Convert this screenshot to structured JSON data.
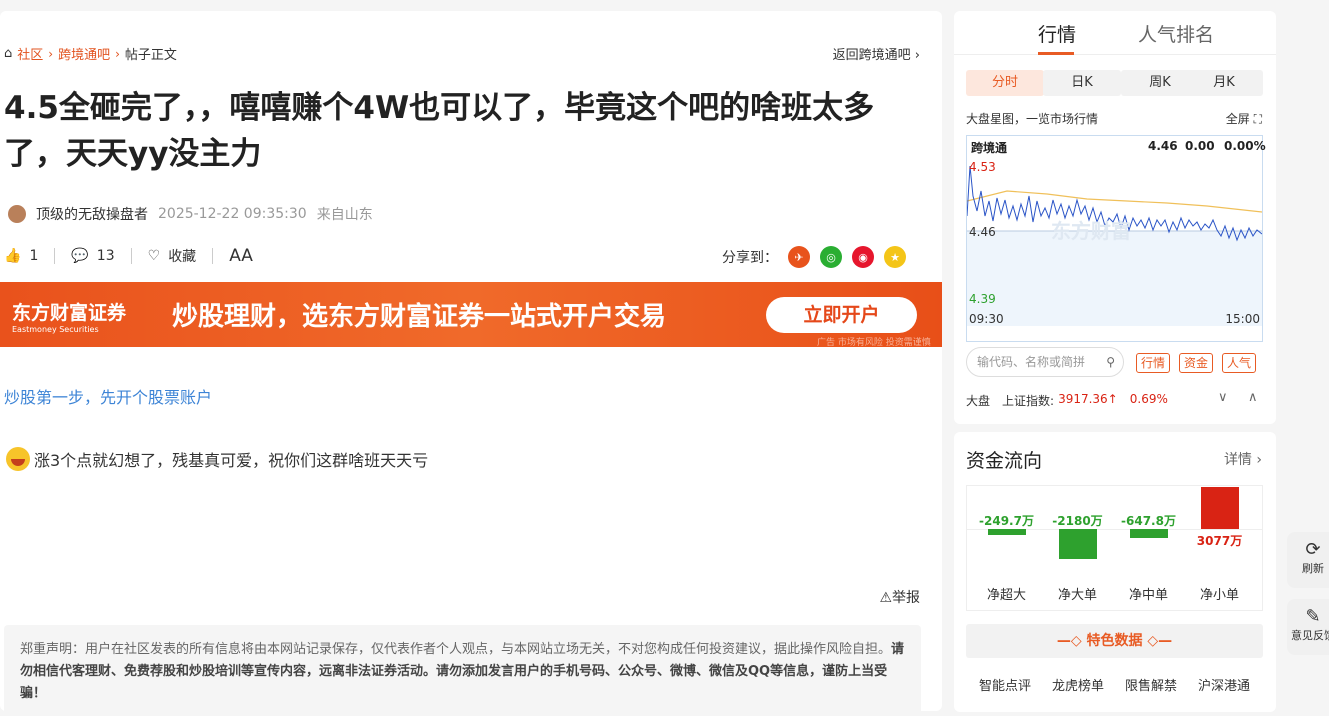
{
  "breadcrumb": {
    "home": "社区",
    "bar": "跨境通吧",
    "current": "帖子正文",
    "back": "返回跨境通吧"
  },
  "post": {
    "title": "4.5全砸完了，，嘻嘻赚个4W也可以了，毕竟这个吧的啥班太多了，天天yy没主力",
    "author": "顶级的无敌操盘者",
    "time": "2025-12-22 09:35:30",
    "location": "来自山东",
    "likes": "1",
    "comments": "13",
    "favorite": "收藏",
    "fontsize": "AA",
    "share_label": "分享到：",
    "link": "炒股第一步，先开个股票账户",
    "body": "涨3个点就幻想了，残基真可爱，祝你们这群啥班天天亏",
    "report": "举报"
  },
  "banner": {
    "logo": "东方财富证券",
    "logo_en": "Eastmoney Securities",
    "slogan": "炒股理财，选东方财富证券一站式开户交易",
    "button": "立即开户",
    "tiny": "广告 市场有风险 投资需谨慎"
  },
  "disclaimer": {
    "lead": "郑重声明：用户在社区发表的所有信息将由本网站记录保存，仅代表作者个人观点，与本网站立场无关，不对您构成任何投资建议，据此操作风险自担。",
    "bold": "请勿相信代客理财、免费荐股和炒股培训等宣传内容，远离非法证券活动。请勿添加发言用户的手机号码、公众号、微博、微信及QQ等信息，谨防上当受骗！"
  },
  "market": {
    "tab1": "行情",
    "tab2": "人气排名",
    "k1": "分时",
    "k2": "日K",
    "k3": "周K",
    "k4": "月K",
    "mini": "大盘星图，一览市场行情",
    "full": "全屏",
    "name": "跨境通",
    "price": "4.46",
    "change": "0.00",
    "pct": "0.00%",
    "high": "4.53",
    "mid": "4.46",
    "low": "4.39",
    "t_start": "09:30",
    "t_end": "15:00",
    "watermark": "东方财富",
    "search_ph": "输代码、名称或简拼",
    "tags": [
      "行情",
      "资金",
      "人气"
    ],
    "idx_label": "大盘",
    "idx_name": "上证指数:",
    "idx_value": "3917.36↑",
    "idx_pct": "0.69%"
  },
  "flow": {
    "title": "资金流向",
    "detail": "详情",
    "items": [
      {
        "label": "净超大",
        "value": "-249.7万",
        "num": -249.7
      },
      {
        "label": "净大单",
        "value": "-2180万",
        "num": -2180
      },
      {
        "label": "净中单",
        "value": "-647.8万",
        "num": -647.8
      },
      {
        "label": "净小单",
        "value": "3077万",
        "num": 3077
      }
    ],
    "feature": "特色数据",
    "links": [
      "智能点评",
      "龙虎榜单",
      "限售解禁",
      "沪深港通"
    ]
  },
  "float": {
    "refresh": "刷新",
    "feedback": "意见反馈"
  },
  "colors": {
    "accent": "#e85b24",
    "up": "#d92314",
    "down": "#2ea12e"
  }
}
